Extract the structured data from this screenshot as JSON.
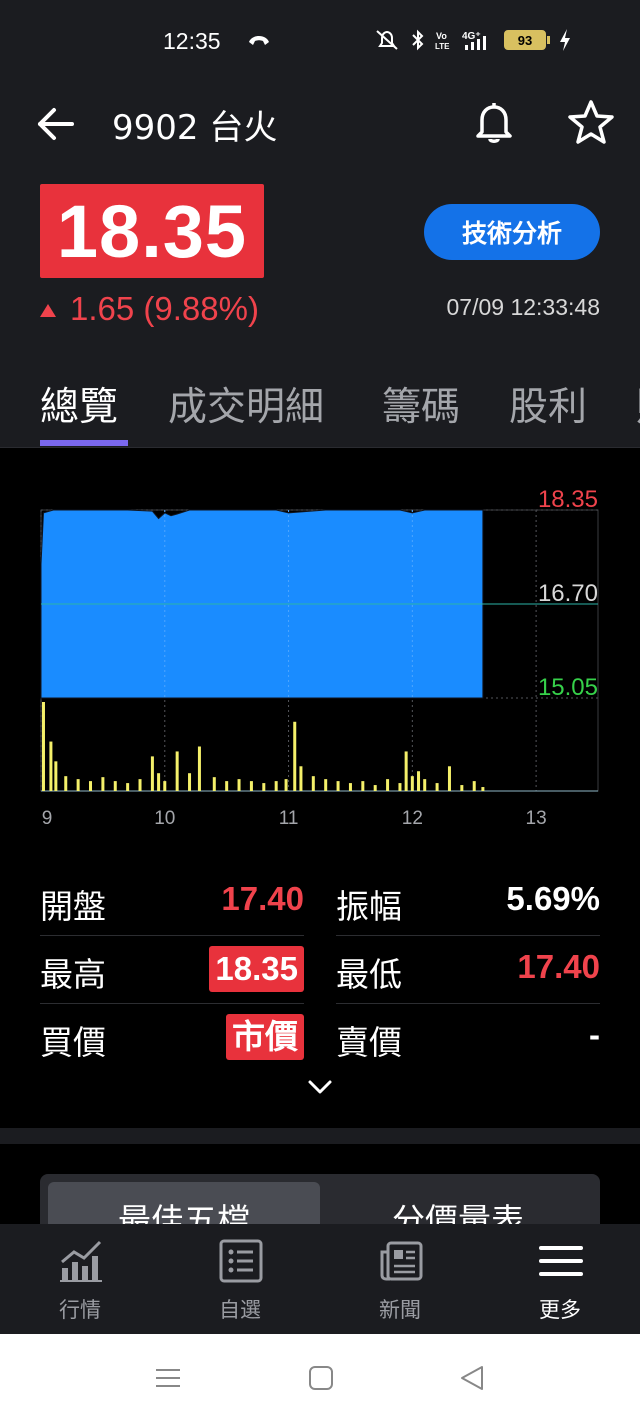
{
  "status_bar": {
    "time": "12:35",
    "battery": "93"
  },
  "header": {
    "title": "9902 台火"
  },
  "quote": {
    "price": "18.35",
    "change": "1.65 (9.88%)",
    "timestamp": "07/09 12:33:48",
    "technical_button": "技術分析",
    "price_color": "#e8323c"
  },
  "tabs": [
    {
      "label": "總覽",
      "active": true
    },
    {
      "label": "成交明細",
      "active": false
    },
    {
      "label": "籌碼",
      "active": false
    },
    {
      "label": "股利",
      "active": false
    },
    {
      "label": "財",
      "active": false
    }
  ],
  "chart_data": {
    "type": "area",
    "y_labels": [
      "18.35",
      "16.70",
      "15.05"
    ],
    "y_range": [
      15.05,
      18.35
    ],
    "reference_price": 16.7,
    "x_labels": [
      "9",
      "10",
      "11",
      "12",
      "13"
    ],
    "price_series_color": "#1a8cff",
    "volume_series_color": "#f5f06a",
    "price_series": {
      "x": [
        9.0,
        9.02,
        9.1,
        9.3,
        9.5,
        9.7,
        9.9,
        9.95,
        10.0,
        10.05,
        10.1,
        10.2,
        10.3,
        10.5,
        10.7,
        10.9,
        11.0,
        11.3,
        11.6,
        11.9,
        12.0,
        12.1,
        12.3,
        12.57
      ],
      "y": [
        17.4,
        18.3,
        18.35,
        18.35,
        18.35,
        18.35,
        18.33,
        18.2,
        18.3,
        18.25,
        18.28,
        18.35,
        18.35,
        18.35,
        18.35,
        18.35,
        18.3,
        18.35,
        18.35,
        18.35,
        18.3,
        18.35,
        18.35,
        18.35
      ]
    },
    "volume_series": {
      "x": [
        9.02,
        9.08,
        9.12,
        9.2,
        9.3,
        9.4,
        9.5,
        9.6,
        9.7,
        9.8,
        9.9,
        9.95,
        10.0,
        10.1,
        10.2,
        10.28,
        10.4,
        10.5,
        10.6,
        10.7,
        10.8,
        10.9,
        10.98,
        11.05,
        11.1,
        11.2,
        11.3,
        11.4,
        11.5,
        11.6,
        11.7,
        11.8,
        11.9,
        11.95,
        12.0,
        12.05,
        12.1,
        12.2,
        12.3,
        12.4,
        12.5,
        12.57
      ],
      "v": [
        90,
        50,
        30,
        15,
        12,
        10,
        14,
        10,
        8,
        12,
        35,
        18,
        10,
        40,
        18,
        45,
        14,
        10,
        12,
        10,
        8,
        10,
        12,
        70,
        25,
        15,
        12,
        10,
        8,
        10,
        6,
        12,
        8,
        40,
        15,
        20,
        12,
        8,
        25,
        6,
        10,
        4
      ]
    }
  },
  "stats": {
    "open_label": "開盤",
    "open_value": "17.40",
    "amplitude_label": "振幅",
    "amplitude_value": "5.69%",
    "high_label": "最高",
    "high_value": "18.35",
    "low_label": "最低",
    "low_value": "17.40",
    "bid_label": "買價",
    "bid_value": "市價",
    "ask_label": "賣價",
    "ask_value": "-"
  },
  "order_tabs": {
    "best_five": "最佳五檔",
    "price_volume": "分價量表"
  },
  "bottom_nav": [
    {
      "label": "行情",
      "icon": "chart-icon",
      "active": false
    },
    {
      "label": "自選",
      "icon": "list-icon",
      "active": false
    },
    {
      "label": "新聞",
      "icon": "news-icon",
      "active": false
    },
    {
      "label": "更多",
      "icon": "menu-icon",
      "active": true
    }
  ]
}
